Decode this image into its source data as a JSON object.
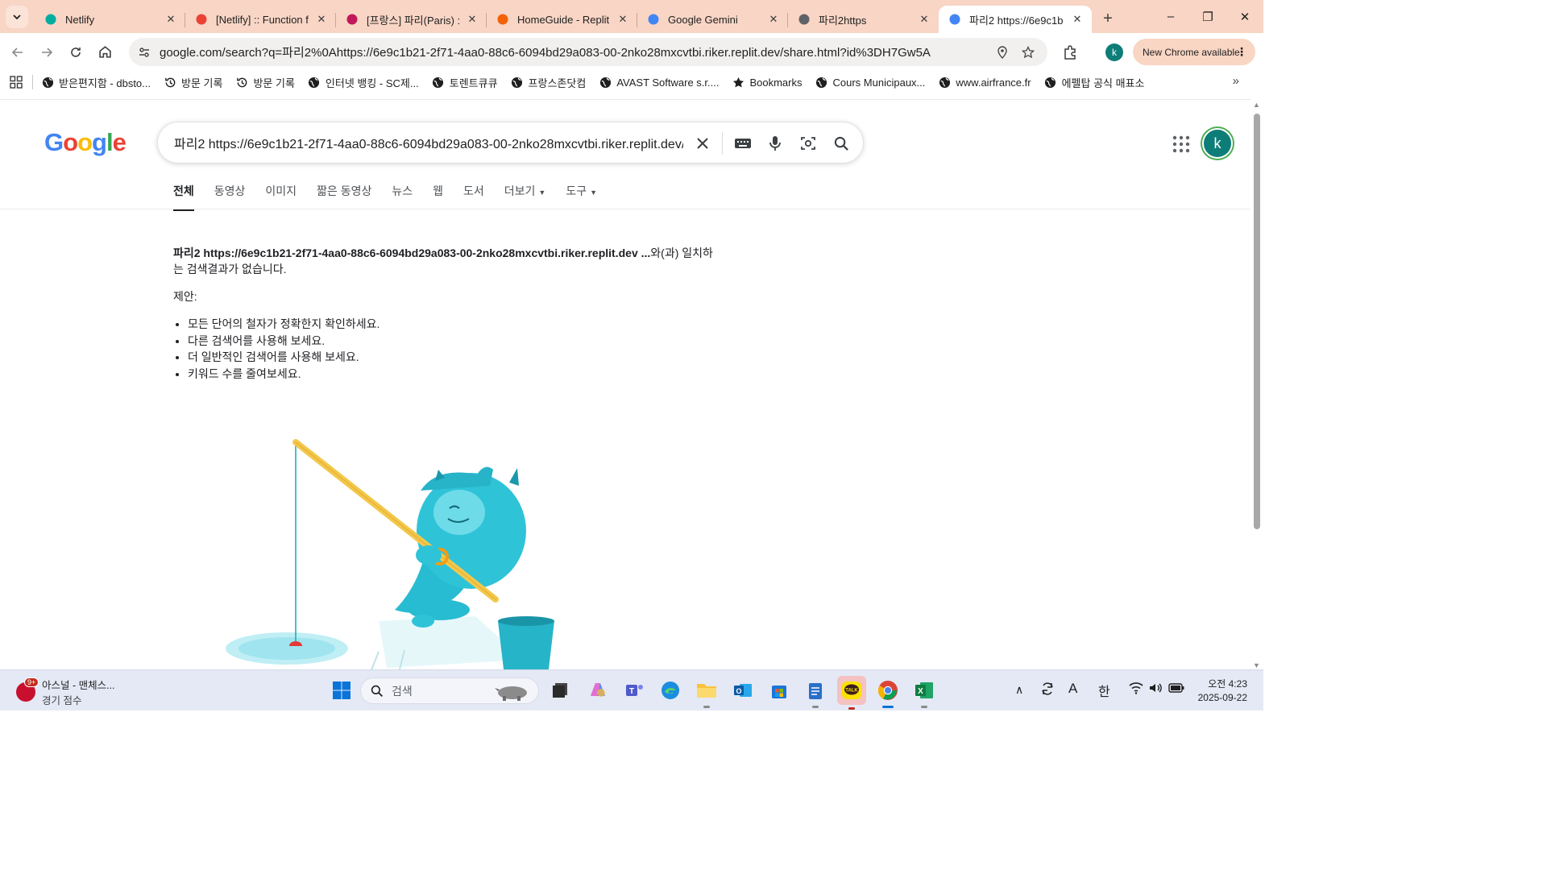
{
  "browser": {
    "tabs": [
      {
        "title": "Netlify",
        "favicon": "netlify-icon",
        "color": "#00ad9f"
      },
      {
        "title": "[Netlify] :: Function f",
        "favicon": "gmail-icon",
        "color": "#ea4335"
      },
      {
        "title": "[프랑스] 파리(Paris) :",
        "favicon": "book-icon",
        "color": "#c2185b"
      },
      {
        "title": "HomeGuide - Replit",
        "favicon": "replit-icon",
        "color": "#f26207"
      },
      {
        "title": "Google Gemini",
        "favicon": "gemini-icon",
        "color": "#4285f4"
      },
      {
        "title": "파리2https",
        "favicon": "globe-icon",
        "color": "#5f6368"
      },
      {
        "title": "파리2 https://6e9c1b",
        "favicon": "google-icon",
        "color": "#4285f4",
        "active": true
      }
    ],
    "url": "google.com/search?q=파리2%0Ahttps://6e9c1b21-2f71-4aa0-88c6-6094bd29a083-00-2nko28mxcvtbi.riker.replit.dev/share.html?id%3DH7Gw5A",
    "profile_initial": "k",
    "update_label": "New Chrome available",
    "bookmarks": [
      {
        "label": "받은편지함 - dbsto...",
        "icon": "globe-icon"
      },
      {
        "label": "방문 기록",
        "icon": "history-icon"
      },
      {
        "label": "방문 기록",
        "icon": "history-icon"
      },
      {
        "label": "인터넷 뱅킹 - SC제...",
        "icon": "globe-icon"
      },
      {
        "label": "토렌트큐큐",
        "icon": "globe-icon"
      },
      {
        "label": "프랑스존닷컴",
        "icon": "globe-icon"
      },
      {
        "label": "AVAST Software s.r....",
        "icon": "globe-icon"
      },
      {
        "label": "Bookmarks",
        "icon": "star-icon"
      },
      {
        "label": "Cours Municipaux...",
        "icon": "globe-icon"
      },
      {
        "label": "www.airfrance.fr",
        "icon": "globe-icon"
      },
      {
        "label": "에펠탑 공식 매표소",
        "icon": "globe-icon"
      }
    ]
  },
  "google": {
    "logo": "Google",
    "query": "파리2 https://6e9c1b21-2f71-4aa0-88c6-6094bd29a083-00-2nko28mxcvtbi.riker.replit.dev/share.html?id=H7Gw5A",
    "user_initial": "k",
    "tabs": [
      "전체",
      "동영상",
      "이미지",
      "짧은 동영상",
      "뉴스",
      "웹",
      "도서",
      "더보기",
      "도구"
    ],
    "no_results": {
      "query_bold": "파리2 https://6e9c1b21-2f71-4aa0-88c6-6094bd29a083-00-2nko28mxcvtbi.riker.replit.dev ...",
      "message": "와(과) 일치하는 검색결과가 없습니다.",
      "suggestions_title": "제안:",
      "suggestions": [
        "모든 단어의 철자가 정확한지 확인하세요.",
        "다른 검색어를 사용해 보세요.",
        "더 일반적인 검색어를 사용해 보세요.",
        "키워드 수를 줄여보세요."
      ]
    }
  },
  "taskbar": {
    "news_badge": "9+",
    "news_title": "아스널 - 맨체스...",
    "news_subtitle": "경기 점수",
    "search_placeholder": "검색",
    "ime": "한",
    "ime_mode": "A",
    "time": "오전 4:23",
    "date": "2025-09-22"
  }
}
